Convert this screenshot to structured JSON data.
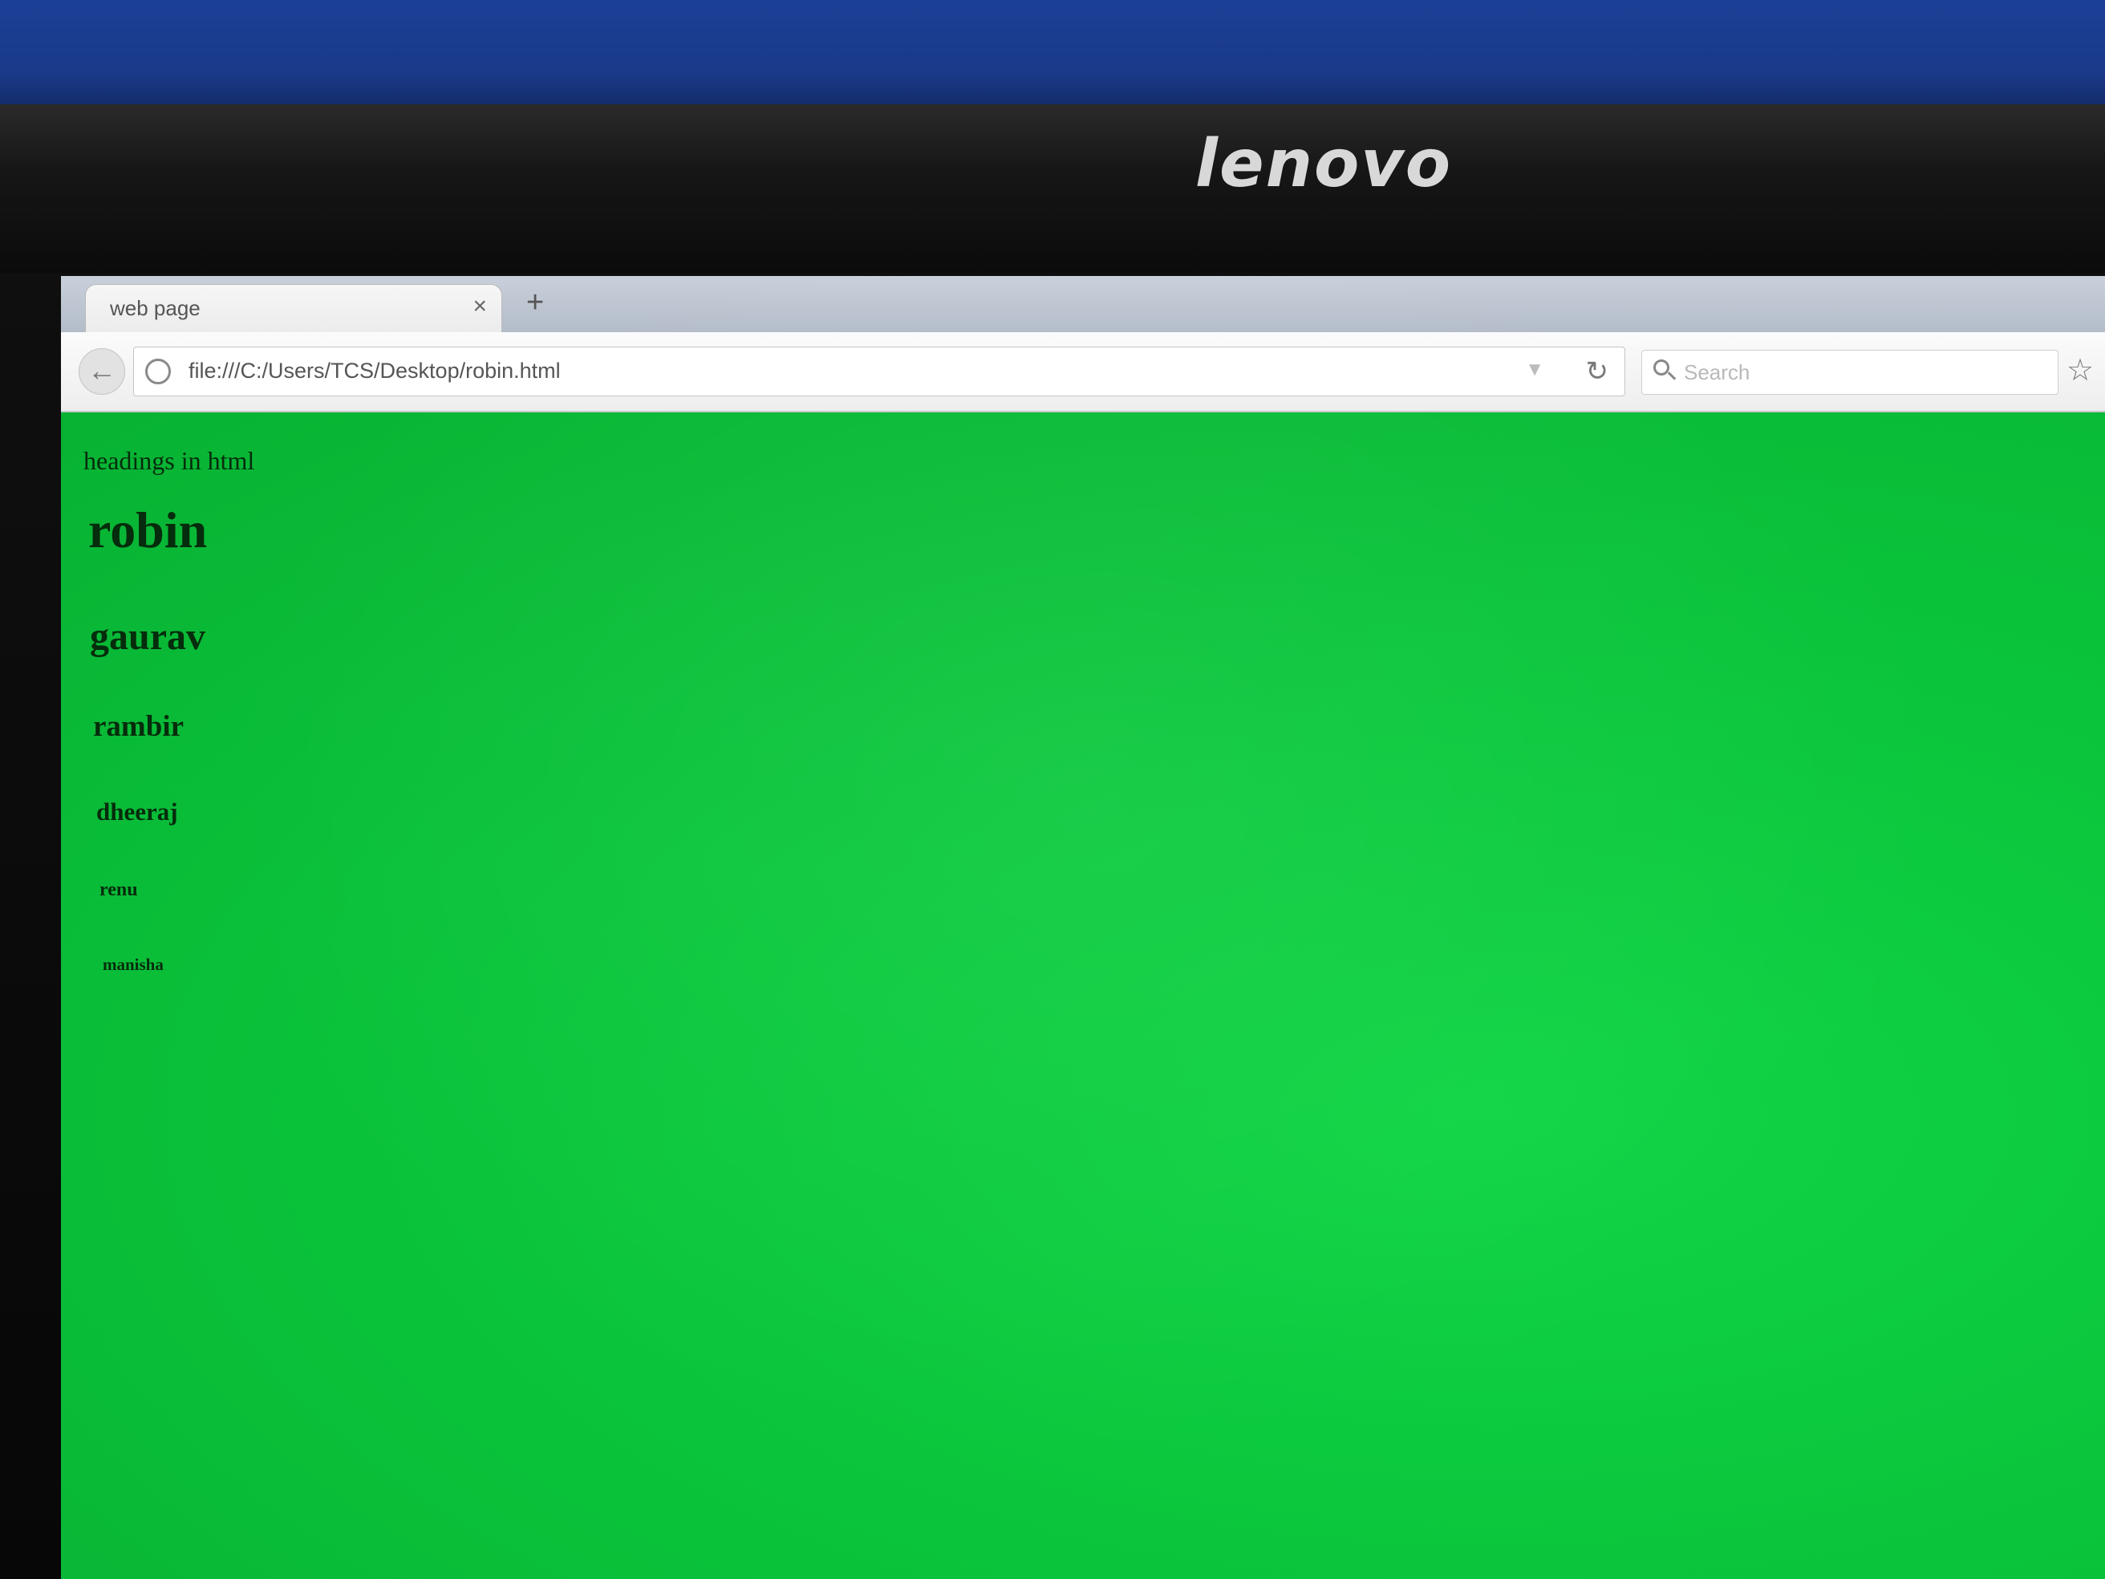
{
  "monitor": {
    "brand": "lenovo"
  },
  "browser": {
    "tab": {
      "title": "web page",
      "close_glyph": "×",
      "new_tab_glyph": "+"
    },
    "toolbar": {
      "back_glyph": "←",
      "url": "file:///C:/Users/TCS/Desktop/robin.html",
      "dropmarker_glyph": "▼",
      "reload_glyph": "↻",
      "search_placeholder": "Search",
      "bookmark_glyph": "☆"
    }
  },
  "page": {
    "background_color": "#0ac23a",
    "paragraph": "headings in html",
    "h1": "robin",
    "h2": "gaurav",
    "h3": "rambir",
    "h4": "dheeraj",
    "h5": "renu",
    "h6": "manisha"
  },
  "icons": {
    "back": "back-arrow-icon",
    "site": "globe-icon",
    "reload": "reload-icon",
    "search": "search-icon",
    "bookmark": "star-icon",
    "cursor": "mouse-pointer-icon"
  }
}
